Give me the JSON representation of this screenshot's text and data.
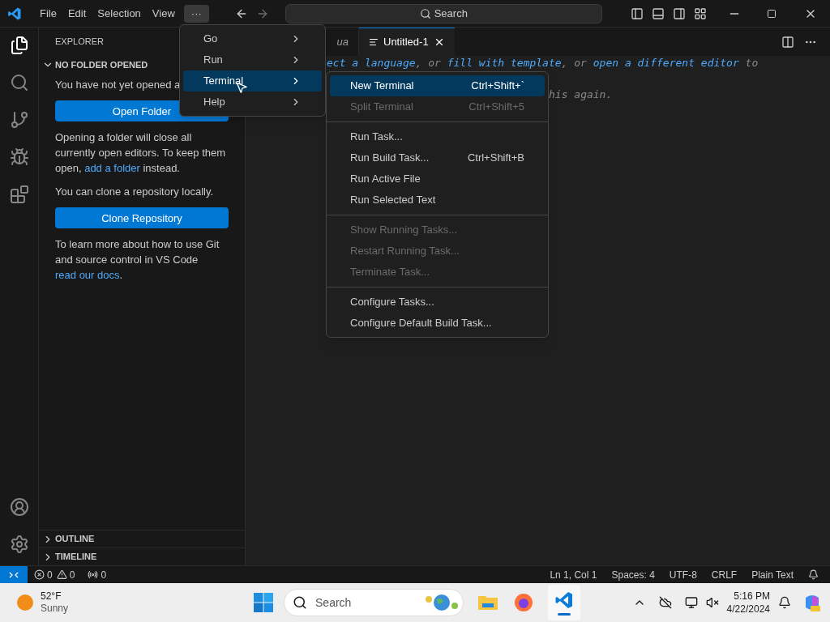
{
  "title_bar": {
    "menus": [
      "File",
      "Edit",
      "Selection",
      "View"
    ],
    "more": "···",
    "search": {
      "placeholder": "Search"
    }
  },
  "sidebar": {
    "title": "EXPLORER",
    "section": {
      "label": "NO FOLDER OPENED",
      "expanded": true
    },
    "blocks": [
      {
        "kind": "text",
        "parts": [
          {
            "kind": "text",
            "text": "You have not yet opened a"
          }
        ]
      },
      {
        "kind": "button",
        "text": "Open Folder"
      },
      {
        "kind": "text",
        "parts": [
          {
            "kind": "text",
            "text": "Opening a folder will close all currently open editors. To keep them open, "
          },
          {
            "kind": "link",
            "text": "add a folder"
          },
          {
            "kind": "text",
            "text": " instead."
          }
        ]
      },
      {
        "kind": "text",
        "parts": [
          {
            "kind": "text",
            "text": "You can clone a repository locally."
          }
        ]
      },
      {
        "kind": "button",
        "text": "Clone Repository"
      },
      {
        "kind": "text",
        "parts": [
          {
            "kind": "text",
            "text": "To learn more about how to use Git and source control in VS Code "
          },
          {
            "kind": "link",
            "text": "read our docs"
          },
          {
            "kind": "text",
            "text": "."
          }
        ]
      }
    ],
    "panels": [
      {
        "label": "OUTLINE",
        "expanded": false
      },
      {
        "label": "TIMELINE",
        "expanded": false
      }
    ]
  },
  "tabs": [
    {
      "label": "ua",
      "selected": false
    },
    {
      "label": "Untitled-1",
      "selected": true
    }
  ],
  "editor": {
    "lines": [
      [
        {
          "kind": "link",
          "text": "ect a language"
        },
        {
          "kind": "text",
          "text": ", or "
        },
        {
          "kind": "link",
          "text": "fill with template"
        },
        {
          "kind": "text",
          "text": ", or "
        },
        {
          "kind": "link",
          "text": "open a different editor"
        },
        {
          "kind": "text",
          "text": " to"
        }
      ],
      [
        {
          "kind": "text",
          "text": "his again."
        }
      ]
    ]
  },
  "menu": {
    "items": [
      {
        "label": "Go",
        "selected": false
      },
      {
        "label": "Run",
        "selected": false
      },
      {
        "label": "Terminal",
        "selected": true
      },
      {
        "label": "Help",
        "selected": false
      }
    ]
  },
  "submenu": {
    "groups": [
      [
        {
          "label": "New Terminal",
          "shortcut": "Ctrl+Shift+`",
          "disabled": false,
          "selected": true
        },
        {
          "label": "Split Terminal",
          "shortcut": "Ctrl+Shift+5",
          "disabled": true,
          "selected": false
        }
      ],
      [
        {
          "label": "Run Task...",
          "disabled": false,
          "selected": false
        },
        {
          "label": "Run Build Task...",
          "shortcut": "Ctrl+Shift+B",
          "disabled": false,
          "selected": false
        },
        {
          "label": "Run Active File",
          "disabled": false,
          "selected": false
        },
        {
          "label": "Run Selected Text",
          "disabled": false,
          "selected": false
        }
      ],
      [
        {
          "label": "Show Running Tasks...",
          "disabled": true,
          "selected": false
        },
        {
          "label": "Restart Running Task...",
          "disabled": true,
          "selected": false
        },
        {
          "label": "Terminate Task...",
          "disabled": true,
          "selected": false
        }
      ],
      [
        {
          "label": "Configure Tasks...",
          "disabled": false,
          "selected": false
        },
        {
          "label": "Configure Default Build Task...",
          "disabled": false,
          "selected": false
        }
      ]
    ]
  },
  "status_bar": {
    "errors": "0",
    "warnings": "0",
    "ports": "0",
    "right": [
      "Ln 1, Col 1",
      "Spaces: 4",
      "UTF-8",
      "CRLF",
      "Plain Text"
    ]
  },
  "taskbar": {
    "weather": {
      "temp": "52°F",
      "condition": "Sunny"
    },
    "search": {
      "placeholder": "Search"
    },
    "time": "5:16 PM",
    "date": "4/22/2024"
  }
}
